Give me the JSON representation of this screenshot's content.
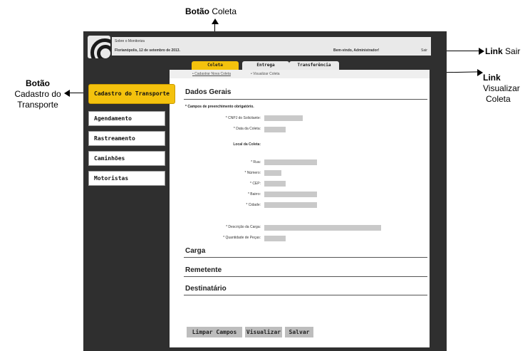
{
  "annotations": {
    "coleta_bold": "Botão",
    "coleta_rest": "Coleta",
    "sair_bold": "Link",
    "sair_rest": "Sair",
    "visualizar_bold": "Link",
    "visualizar_line1": "Visualizar",
    "visualizar_line2": "Coleta",
    "cadastro_bold": "Botão",
    "cadastro_line1": "Cadastro do",
    "cadastro_line2": "Transporte"
  },
  "header": {
    "about_link": "Sobre o Monitoriza",
    "date_text": "Florianópolis, 12 de setembro de 2013.",
    "welcome_text": "Bem-vindo, Administrador!",
    "sair_link": "Sair"
  },
  "tabs": [
    {
      "label": "Coleta",
      "active": true
    },
    {
      "label": "Entrega",
      "active": false
    },
    {
      "label": "Transferência",
      "active": false
    }
  ],
  "subnav": {
    "item1": "Cadastrar Nova Coleta",
    "item2": "Visualizar Coleta"
  },
  "sidebar": {
    "items": [
      {
        "label": "Cadastro do Transporte",
        "active": true
      },
      {
        "label": "Agendamento"
      },
      {
        "label": "Rastreamento"
      },
      {
        "label": "Caminhões"
      },
      {
        "label": "Motoristas"
      }
    ]
  },
  "form": {
    "title": "Dados Gerais",
    "required_note": "* Campos de preenchimento obrigatório.",
    "cnpj_label": "* CNPJ do Solicitante:",
    "data_label": "* Data da Coleta:",
    "local_heading": "Local da Coleta:",
    "rua_label": "* Rua:",
    "numero_label": "* Número:",
    "cep_label": "* CEP:",
    "bairro_label": "* Bairro:",
    "cidade_label": "* Cidade:",
    "descricao_label": "* Descrição da Carga:",
    "quantidade_label": "* Quantidade de Peças:"
  },
  "sections": {
    "carga": "Carga",
    "remetente": "Remetente",
    "destinatario": "Destinatário"
  },
  "buttons": {
    "limpar": "Limpar Campos",
    "visualizar": "Visualizar",
    "salvar": "Salvar"
  }
}
